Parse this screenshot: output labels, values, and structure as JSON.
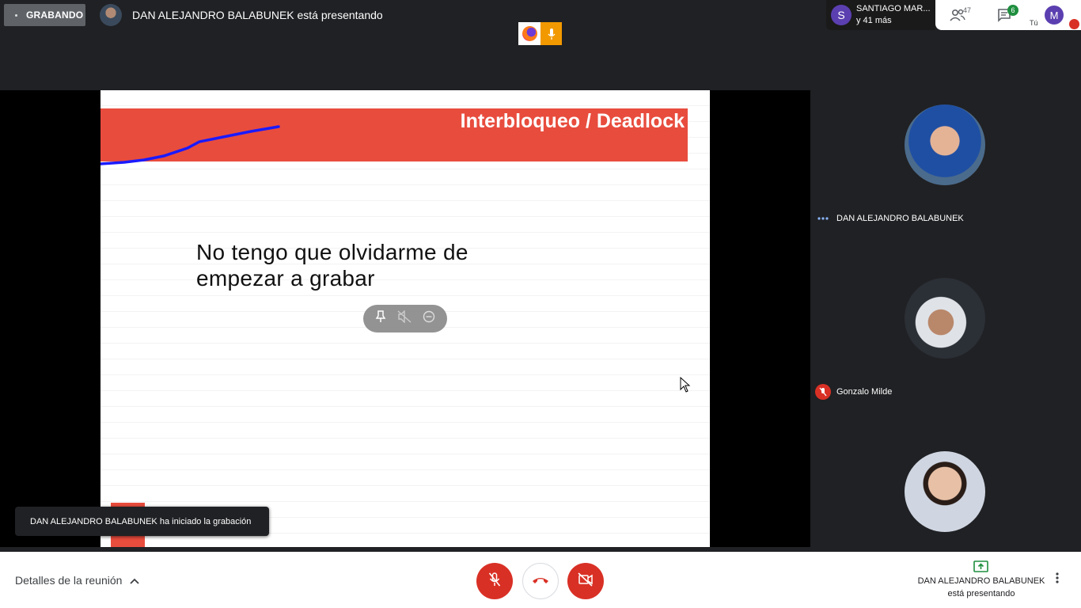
{
  "topbar": {
    "recording_label": "GRABANDO",
    "presenter_text": "DAN ALEJANDRO BALABUNEK está presentando"
  },
  "participants_chip": {
    "avatar_letter": "S",
    "name": "SANTIAGO MAR...",
    "more": "y 41 más"
  },
  "top_controls": {
    "people_count": "47",
    "chat_count": "6",
    "self_label": "Tú",
    "self_avatar": "M"
  },
  "slide": {
    "title": "Interbloqueo / Deadlock",
    "body_line1": "No tengo que olvidarme de",
    "body_line2": "empezar a grabar"
  },
  "toast": {
    "text": "DAN ALEJANDRO BALABUNEK ha iniciado la grabación"
  },
  "tiles": [
    {
      "name": "DAN ALEJANDRO BALABUNEK",
      "indicator": "speaking-dots-icon"
    },
    {
      "name": "Gonzalo Milde",
      "indicator": "mic-off-icon"
    },
    {
      "name": "",
      "indicator": ""
    }
  ],
  "bottombar": {
    "details_label": "Detalles de la reunión",
    "presenting_name": "DAN ALEJANDRO BALABUNEK",
    "presenting_sub": "está presentando"
  },
  "colors": {
    "background": "#202124",
    "slide_accent": "#e84c3d",
    "danger": "#d93025",
    "chat_badge": "#1e8e3e",
    "present_icon": "#1e8e3e"
  }
}
